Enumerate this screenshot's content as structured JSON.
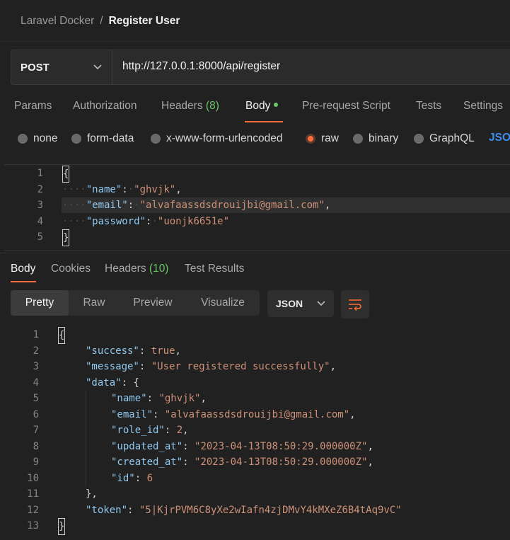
{
  "breadcrumb": {
    "parent": "Laravel Docker",
    "separator": "/",
    "current": "Register User"
  },
  "request": {
    "method": "POST",
    "url": "http://127.0.0.1:8000/api/register",
    "tabs": {
      "params": "Params",
      "authorization": "Authorization",
      "headers": "Headers",
      "headers_count": "(8)",
      "body": "Body",
      "pre_request": "Pre-request Script",
      "tests": "Tests",
      "settings": "Settings"
    },
    "body_types": {
      "none": "none",
      "form_data": "form-data",
      "urlencoded": "x-www-form-urlencoded",
      "raw": "raw",
      "binary": "binary",
      "graphql": "GraphQL",
      "json": "JSO"
    },
    "selected_body_type": "raw",
    "line_numbers": [
      "1",
      "2",
      "3",
      "4",
      "5"
    ],
    "body": {
      "name_key": "\"name\"",
      "name_value": "\"ghvjk\"",
      "email_key": "\"email\"",
      "email_value": "\"alvafaassdsdrouijbi@gmail.com\"",
      "password_key": "\"password\"",
      "password_value": "\"uonjk6651e\""
    }
  },
  "response": {
    "tabs": {
      "body": "Body",
      "cookies": "Cookies",
      "headers": "Headers",
      "headers_count": "(10)",
      "test_results": "Test Results"
    },
    "views": {
      "pretty": "Pretty",
      "raw": "Raw",
      "preview": "Preview",
      "visualize": "Visualize"
    },
    "format": "JSON",
    "line_numbers": [
      "1",
      "2",
      "3",
      "4",
      "5",
      "6",
      "7",
      "8",
      "9",
      "10",
      "11",
      "12",
      "13"
    ],
    "body": {
      "success_key": "\"success\"",
      "success_value": "true",
      "message_key": "\"message\"",
      "message_value": "\"User registered successfully\"",
      "data_key": "\"data\"",
      "name_key": "\"name\"",
      "name_value": "\"ghvjk\"",
      "email_key": "\"email\"",
      "email_value": "\"alvafaassdsdrouijbi@gmail.com\"",
      "role_id_key": "\"role_id\"",
      "role_id_value": "2",
      "updated_at_key": "\"updated_at\"",
      "updated_at_value": "\"2023-04-13T08:50:29.000000Z\"",
      "created_at_key": "\"created_at\"",
      "created_at_value": "\"2023-04-13T08:50:29.000000Z\"",
      "id_key": "\"id\"",
      "id_value": "6",
      "token_key": "\"token\"",
      "token_value": "\"5|KjrPVM6C8yXe2wIafn4zjDMvY4kMXeZ6B4tAq9vC\""
    }
  },
  "colors": {
    "accent": "#ff6c37",
    "green": "#6bc56b",
    "link": "#3d8ef0"
  },
  "icons": {
    "method_chevron": "chevron-down-icon",
    "format_chevron": "chevron-down-icon",
    "wrap": "wrap-lines-icon"
  }
}
